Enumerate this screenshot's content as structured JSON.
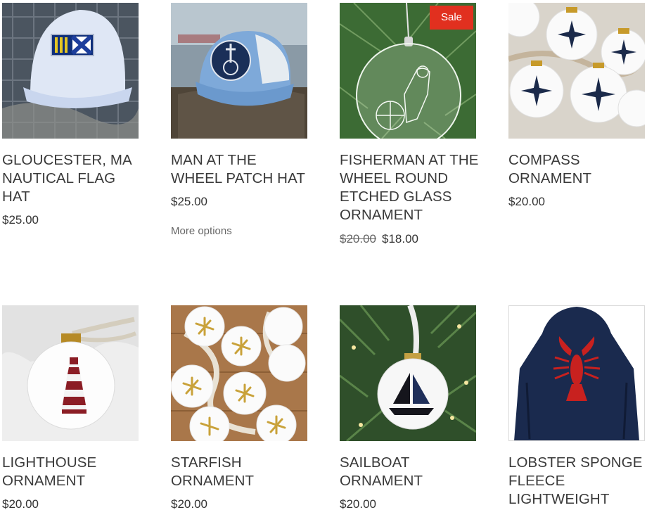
{
  "products": [
    {
      "title": "GLOUCESTER, MA NAUTICAL FLAG HAT",
      "price": "$25.00",
      "image_icon": "white-cap-with-flag-patch-icon"
    },
    {
      "title": "MAN AT THE WHEEL PATCH HAT",
      "price": "$25.00",
      "more_options": "More options",
      "image_icon": "blue-cap-with-man-at-wheel-patch-icon"
    },
    {
      "title": "FISHERMAN AT THE WHEEL ROUND ETCHED GLASS ORNAMENT",
      "old_price": "$20.00",
      "price": "$18.00",
      "badge": "Sale",
      "image_icon": "etched-glass-ornament-icon"
    },
    {
      "title": "COMPASS ORNAMENT",
      "price": "$20.00",
      "image_icon": "compass-ornaments-icon"
    },
    {
      "title": "LIGHTHOUSE ORNAMENT",
      "price": "$20.00",
      "image_icon": "lighthouse-ornament-icon"
    },
    {
      "title": "STARFISH ORNAMENT",
      "price": "$20.00",
      "image_icon": "starfish-ornaments-icon"
    },
    {
      "title": "SAILBOAT ORNAMENT",
      "price": "$20.00",
      "image_icon": "sailboat-ornament-icon"
    },
    {
      "title": "LOBSTER SPONGE FLEECE LIGHTWEIGHT",
      "price": "",
      "image_icon": "navy-lobster-hoodie-icon"
    }
  ],
  "colors": {
    "sale_badge": "#e1301f",
    "text": "#3a3a3a",
    "muted": "#666666"
  }
}
